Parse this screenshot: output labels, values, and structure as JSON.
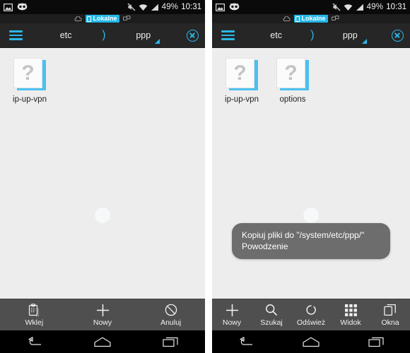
{
  "app": {
    "name": "File Manager (Polish)",
    "accent_color": "#2ab7e8",
    "toolbar_bg": "#262626",
    "content_bg": "#ededed",
    "actionbar_bg": "#4f4f4f",
    "toast_bg": "#6d6d6d"
  },
  "statusbar": {
    "icons_left": [
      "screenshot-icon",
      "cyanogenmod-icon"
    ],
    "icons_right": [
      "mute-icon",
      "wifi-icon",
      "signal-icon"
    ],
    "battery": "49%",
    "time": "10:31"
  },
  "substatus": {
    "cloud_icon": "cloud-icon",
    "chip_label": "Lokalne",
    "chip_icon": "device-icon",
    "network_icon": "network-icon"
  },
  "toolbar": {
    "menu_icon": "hamburger-menu-icon",
    "crumb_root": "etc",
    "separator": ")",
    "crumb_current": "ppp",
    "dropdown_icon": "triangle-dropdown-icon",
    "close_icon": "close-circle-icon"
  },
  "left_panel": {
    "files": [
      {
        "name": "ip-up-vpn",
        "icon": "unknown-file-icon"
      }
    ],
    "spinner": "loading-spinner",
    "actions": [
      {
        "label": "Wklej",
        "icon": "paste-clipboard-icon"
      },
      {
        "label": "Nowy",
        "icon": "plus-icon"
      },
      {
        "label": "Anuluj",
        "icon": "cancel-circle-slash-icon"
      }
    ]
  },
  "right_panel": {
    "files": [
      {
        "name": "ip-up-vpn",
        "icon": "unknown-file-icon"
      },
      {
        "name": "options",
        "icon": "unknown-file-icon"
      }
    ],
    "spinner": "loading-spinner",
    "toast": {
      "line1": "Kopiuj pliki do \"/system/etc/ppp/\"",
      "line2": "Powodzenie"
    },
    "actions": [
      {
        "label": "Nowy",
        "icon": "plus-icon"
      },
      {
        "label": "Szukaj",
        "icon": "search-icon"
      },
      {
        "label": "Odśwież",
        "icon": "refresh-icon"
      },
      {
        "label": "Widok",
        "icon": "grid-view-icon"
      },
      {
        "label": "Okna",
        "icon": "windows-copy-icon"
      }
    ]
  },
  "navbar": {
    "back": "back-arrow-icon",
    "home": "home-icon",
    "recents": "recents-icon"
  }
}
